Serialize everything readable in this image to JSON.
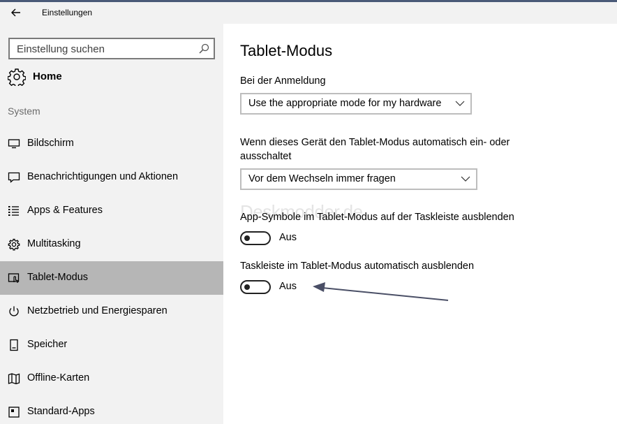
{
  "window": {
    "title": "Einstellungen"
  },
  "sidebar": {
    "search_placeholder": "Einstellung suchen",
    "home_label": "Home",
    "section_label": "System",
    "items": [
      {
        "label": "Bildschirm",
        "icon": "monitor-icon",
        "selected": false
      },
      {
        "label": "Benachrichtigungen und Aktionen",
        "icon": "notification-icon",
        "selected": false
      },
      {
        "label": "Apps & Features",
        "icon": "list-icon",
        "selected": false
      },
      {
        "label": "Multitasking",
        "icon": "multitasking-icon",
        "selected": false
      },
      {
        "label": "Tablet-Modus",
        "icon": "tablet-mode-icon",
        "selected": true
      },
      {
        "label": "Netzbetrieb und Energiesparen",
        "icon": "power-icon",
        "selected": false
      },
      {
        "label": "Speicher",
        "icon": "storage-icon",
        "selected": false
      },
      {
        "label": "Offline-Karten",
        "icon": "map-icon",
        "selected": false
      },
      {
        "label": "Standard-Apps",
        "icon": "default-apps-icon",
        "selected": false
      }
    ]
  },
  "main": {
    "title": "Tablet-Modus",
    "signin_label": "Bei der Anmeldung",
    "signin_value": "Use the appropriate mode for my hardware",
    "switch_label": "Wenn dieses Gerät den Tablet-Modus automatisch ein- oder ausschaltet",
    "switch_value": "Vor dem Wechseln immer fragen",
    "watermark": "Deskmodder.de",
    "hide_icons_label": "App-Symbole im Tablet-Modus auf der Taskleiste ausblenden",
    "hide_icons_state": "Aus",
    "hide_taskbar_label": "Taskleiste im Tablet-Modus automatisch ausblenden",
    "hide_taskbar_state": "Aus"
  },
  "colors": {
    "sidebar_bg": "#f2f2f2",
    "selected_bg": "#b6b6b6",
    "arrow": "#4a4f66"
  }
}
